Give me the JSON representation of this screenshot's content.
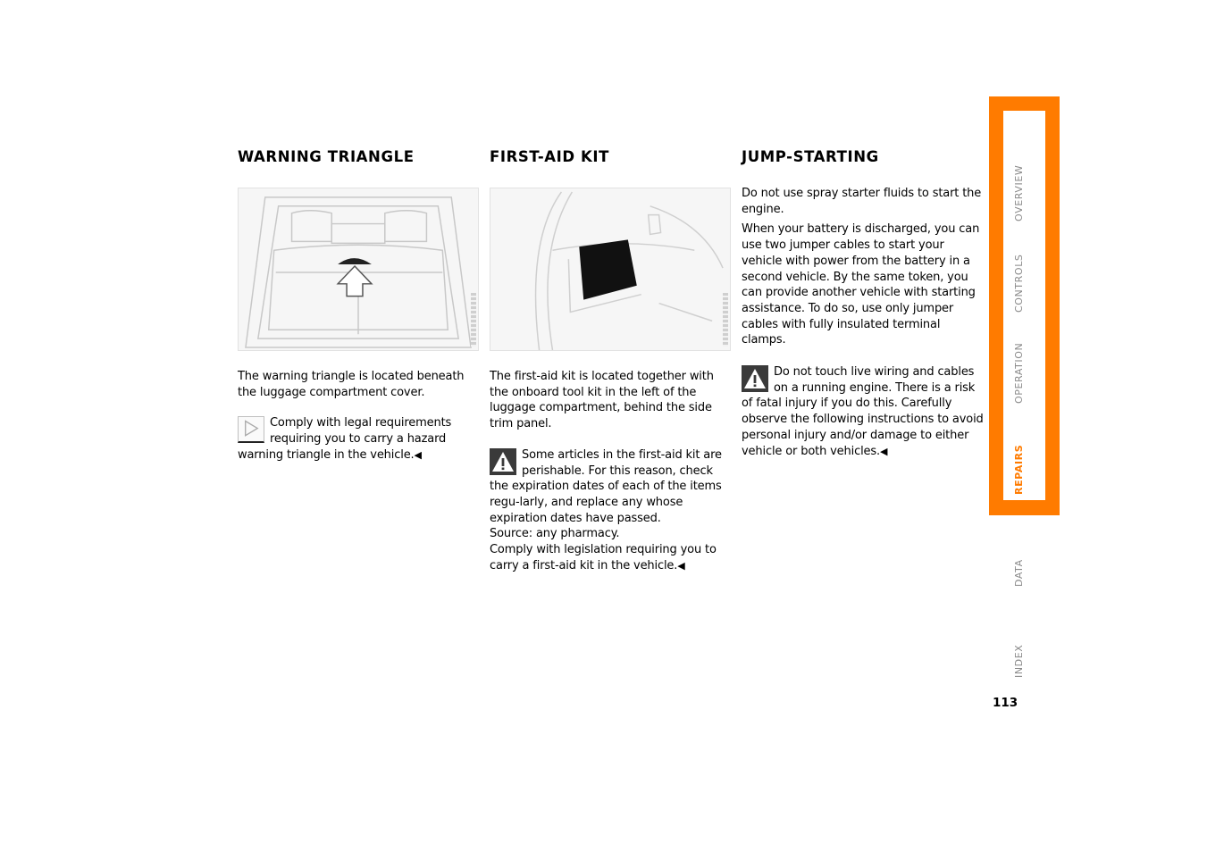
{
  "sections": [
    {
      "title": "WARNING TRIANGLE",
      "figure": "luggage-compartment-cover-illustration",
      "intro": "The warning triangle is located beneath the luggage compartment cover.",
      "note": {
        "icon": "arrow-note-icon",
        "text": "Comply with legal requirements requiring you to carry a hazard warning triangle in the vehicle."
      }
    },
    {
      "title": "FIRST-AID KIT",
      "figure": "first-aid-kit-location-illustration",
      "intro": "The first-aid kit is located together with the onboard tool kit in the left of the luggage compartment, behind the side trim panel.",
      "note": {
        "icon": "warning-icon",
        "text": "Some articles in the first-aid kit are perishable. For this reason, check the expiration dates of each of the items regu-larly, and replace any whose expiration dates have passed.",
        "source": "Source: any pharmacy.",
        "legal": "Comply with legislation requiring you to carry a first-aid kit in the vehicle."
      }
    },
    {
      "title": "JUMP-STARTING",
      "para1": "Do not use spray starter fluids to start the engine.",
      "para2": "When your battery is discharged, you can use two jumper cables to start your vehicle with power from the battery in a second vehicle. By the same token, you can provide another vehicle with starting assistance. To do so, use only jumper cables with fully insulated terminal clamps.",
      "note": {
        "icon": "warning-icon",
        "text": "Do not touch live wiring and cables on a running engine. There is a risk of fatal injury if you do this. Carefully observe the following instructions to avoid personal injury and/or damage to either vehicle or both vehicles."
      }
    }
  ],
  "end_mark": "◀",
  "tabs": [
    {
      "label": "OVERVIEW",
      "active": false
    },
    {
      "label": "CONTROLS",
      "active": false
    },
    {
      "label": "OPERATION",
      "active": false
    },
    {
      "label": "REPAIRS",
      "active": true
    },
    {
      "label": "DATA",
      "active": false
    },
    {
      "label": "INDEX",
      "active": false
    }
  ],
  "page_number": "113",
  "colors": {
    "accent": "#ff7b00",
    "tab_text": "#8a8a8a"
  }
}
